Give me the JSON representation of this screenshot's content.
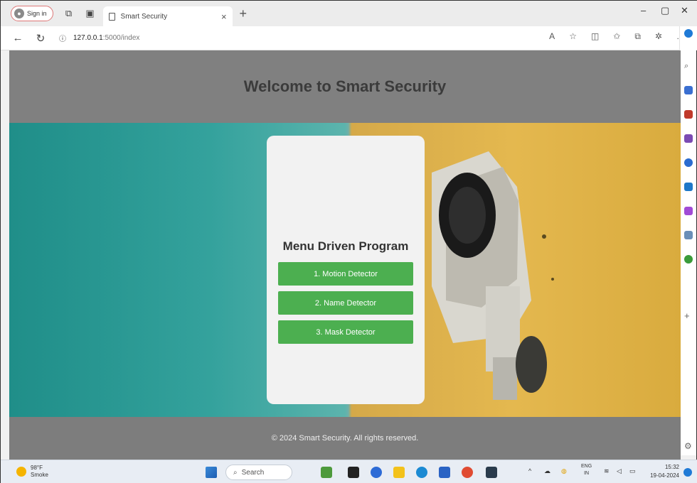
{
  "browser": {
    "signin_label": "Sign in",
    "tab_title": "Smart Security",
    "url_host": "127.0.0.1",
    "url_path": ":5000/index"
  },
  "page": {
    "header_title": "Welcome to Smart Security",
    "menu_title": "Menu Driven Program",
    "menu_items": [
      "1. Motion Detector",
      "2. Name Detector",
      "3. Mask Detector"
    ],
    "footer_text": "© 2024 Smart Security. All rights reserved."
  },
  "taskbar": {
    "weather_temp": "98°F",
    "weather_desc": "Smoke",
    "search_placeholder": "Search",
    "lang_top": "ENG",
    "lang_bottom": "IN",
    "time": "15:32",
    "date": "19-04-2024"
  },
  "colors": {
    "button_green": "#4caf50",
    "header_gray": "#808080"
  }
}
